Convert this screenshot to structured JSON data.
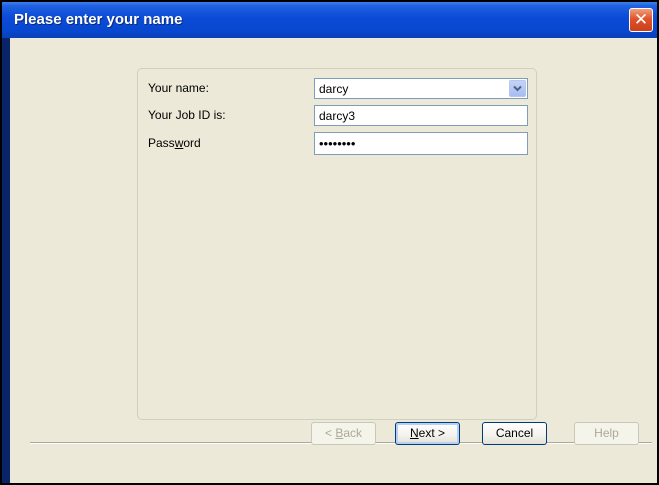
{
  "window": {
    "title": "Please enter your name",
    "close_icon": "close-icon"
  },
  "form": {
    "name_label": "Your name:",
    "name_value": "darcy",
    "job_label": "Your Job ID is:",
    "job_value": "darcy3",
    "password_label_pre": "Pass",
    "password_label_acc": "w",
    "password_label_post": "ord",
    "password_value": "••••••••"
  },
  "buttons": {
    "back_acc": "B",
    "back_rest": "ack",
    "back_prefix": "< ",
    "next_acc": "N",
    "next_rest": "ext >",
    "cancel": "Cancel",
    "help": "Help"
  },
  "colors": {
    "title_bar": "#0a4ad6",
    "dialog_bg": "#ece9d8",
    "close_button": "#e0532a"
  }
}
